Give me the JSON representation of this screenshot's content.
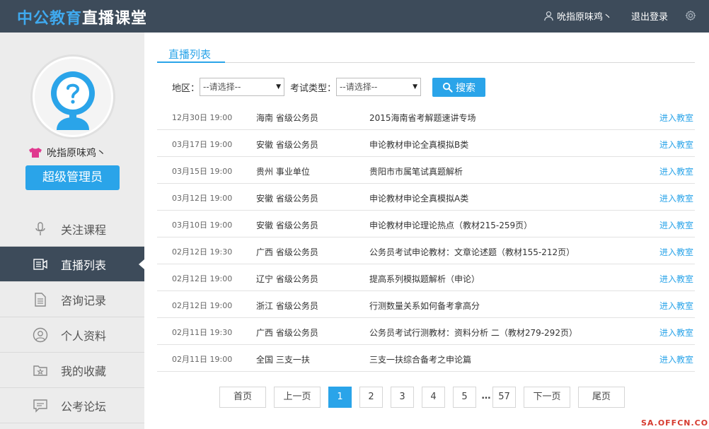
{
  "header": {
    "logo_brand": "中公教育",
    "logo_sub": "直播课堂",
    "username": "吮指原味鸡丶",
    "logout_label": "退出登录",
    "icons": {
      "user": "user-icon",
      "settings": "gear-icon"
    }
  },
  "sidebar": {
    "username": "吮指原味鸡丶",
    "role_label": "超级管理员",
    "menu": [
      {
        "label": "关注课程",
        "icon": "microphone-icon"
      },
      {
        "label": "直播列表",
        "icon": "video-list-icon"
      },
      {
        "label": "咨询记录",
        "icon": "document-icon"
      },
      {
        "label": "个人资料",
        "icon": "profile-icon"
      },
      {
        "label": "我的收藏",
        "icon": "folder-star-icon"
      },
      {
        "label": "公考论坛",
        "icon": "chat-icon"
      }
    ]
  },
  "main": {
    "tab_label": "直播列表",
    "filter": {
      "region_label": "地区：",
      "region_value": "--请选择--",
      "exam_label": "考试类型：",
      "exam_value": "--请选择--",
      "search_label": "搜索"
    },
    "rows": [
      {
        "date": "12月30日 19:00",
        "region": "海南 省级公务员",
        "title": "2015海南省考解题速讲专场",
        "action": "进入教室"
      },
      {
        "date": "03月17日 19:00",
        "region": "安徽 省级公务员",
        "title": "申论教材申论全真模拟B类",
        "action": "进入教室"
      },
      {
        "date": "03月15日 19:00",
        "region": "贵州 事业单位",
        "title": "贵阳市市属笔试真题解析",
        "action": "进入教室"
      },
      {
        "date": "03月12日 19:00",
        "region": "安徽 省级公务员",
        "title": "申论教材申论全真模拟A类",
        "action": "进入教室"
      },
      {
        "date": "03月10日 19:00",
        "region": "安徽 省级公务员",
        "title": "申论教材申论理论热点（教材215-259页）",
        "action": "进入教室"
      },
      {
        "date": "02月12日 19:30",
        "region": "广西 省级公务员",
        "title": "公务员考试申论教材：文章论述题（教材155-212页）",
        "action": "进入教室"
      },
      {
        "date": "02月12日 19:00",
        "region": "辽宁 省级公务员",
        "title": "提高系列模拟题解析（申论）",
        "action": "进入教室"
      },
      {
        "date": "02月12日 19:00",
        "region": "浙江 省级公务员",
        "title": "行测数量关系如何备考拿高分",
        "action": "进入教室"
      },
      {
        "date": "02月11日 19:30",
        "region": "广西 省级公务员",
        "title": "公务员考试行测教材：资料分析 二（教材279-292页）",
        "action": "进入教室"
      },
      {
        "date": "02月11日 19:00",
        "region": "全国 三支一扶",
        "title": "三支一扶综合备考之申论篇",
        "action": "进入教室"
      }
    ],
    "pager": {
      "first": "首页",
      "prev": "上一页",
      "pages": [
        "1",
        "2",
        "3",
        "4",
        "5"
      ],
      "current": "1",
      "dots": "…",
      "last_page": "57",
      "next": "下一页",
      "last": "尾页"
    }
  },
  "watermark": "SA.OFFCN.COM",
  "colors": {
    "accent": "#2aa4e9",
    "header_bg": "#3d4b5a",
    "sidebar_bg": "#ececec"
  }
}
